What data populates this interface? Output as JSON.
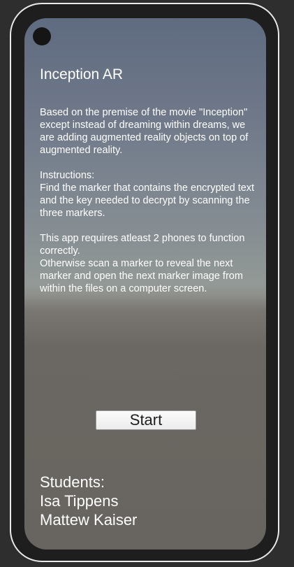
{
  "app": {
    "title": "Inception AR"
  },
  "description": {
    "text": "Based on the premise of the movie \"Inception\" except instead of dreaming within dreams, we are adding augmented reality objects on top of augmented reality.\n\nInstructions:\nFind the marker that contains the encrypted text and the key needed to decrypt by scanning the three markers.\n\nThis app requires atleast 2 phones to function correctly.\nOtherwise scan a marker to reveal the next marker and open the next marker image from within the files on a computer screen."
  },
  "start_button": {
    "label": "Start"
  },
  "credits": {
    "heading": "Students:",
    "names": [
      "Isa Tippens",
      "Mattew Kaiser"
    ]
  }
}
